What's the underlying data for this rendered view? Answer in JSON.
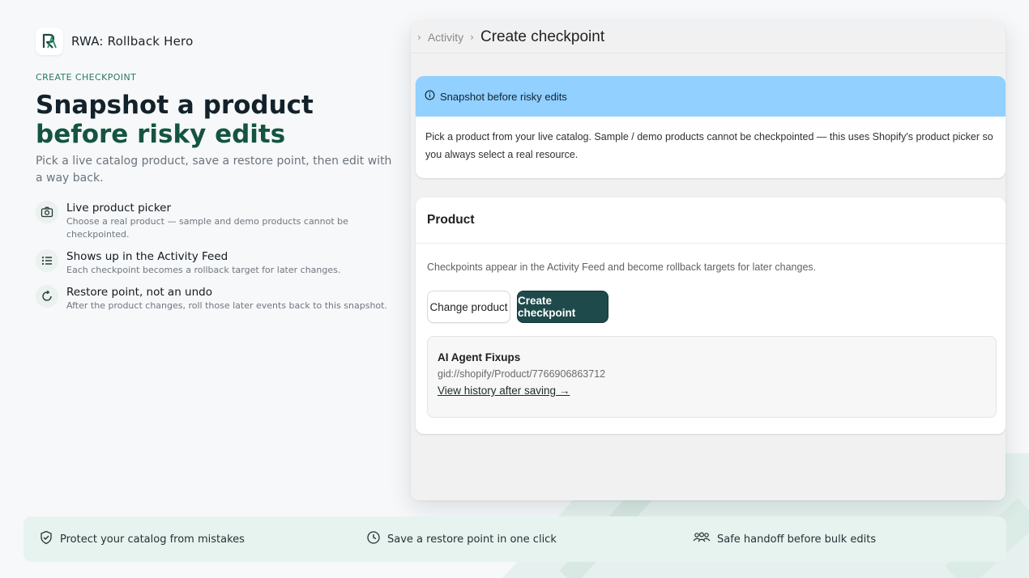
{
  "brand": {
    "name": "RWA: Rollback Hero",
    "logo_icon": "rollback-hero-logo"
  },
  "hero": {
    "eyebrow": "CREATE CHECKPOINT",
    "title_line1": "Snapshot a product",
    "title_line2": "before risky edits",
    "subtitle": "Pick a live catalog product, save a restore point, then edit with a way back."
  },
  "features": [
    {
      "icon": "camera-icon",
      "title": "Live product picker",
      "desc": "Choose a real product — sample and demo products cannot be checkpointed."
    },
    {
      "icon": "list-icon",
      "title": "Shows up in the Activity Feed",
      "desc": "Each checkpoint becomes a rollback target for later changes."
    },
    {
      "icon": "refresh-icon",
      "title": "Restore point, not an undo",
      "desc": "After the product changes, roll those later events back to this snapshot."
    }
  ],
  "app": {
    "breadcrumb": {
      "parent": "Activity",
      "current": "Create checkpoint"
    },
    "banner": {
      "title": "Snapshot before risky edits",
      "body": "Pick a product from your live catalog. Sample / demo products cannot be checkpointed — this uses Shopify's product picker so you always select a real resource."
    },
    "product_card": {
      "title": "Product",
      "description": "Checkpoints appear in the Activity Feed and become rollback targets for later changes.",
      "change_button": "Change product",
      "create_button": "Create checkpoint",
      "selected": {
        "name": "AI Agent Fixups",
        "gid": "gid://shopify/Product/7766906863712",
        "link": "View history after saving →"
      }
    }
  },
  "bottom_strip": [
    {
      "icon": "shield-check-icon",
      "label": "Protect your catalog from mistakes"
    },
    {
      "icon": "clock-icon",
      "label": "Save a restore point in one click"
    },
    {
      "icon": "people-icon",
      "label": "Safe handoff before bulk edits"
    }
  ],
  "colors": {
    "accent_green": "#145440",
    "primary_button": "#1f4a4b",
    "banner_blue": "#91d0ff",
    "strip_bg": "#e6f3ee"
  }
}
